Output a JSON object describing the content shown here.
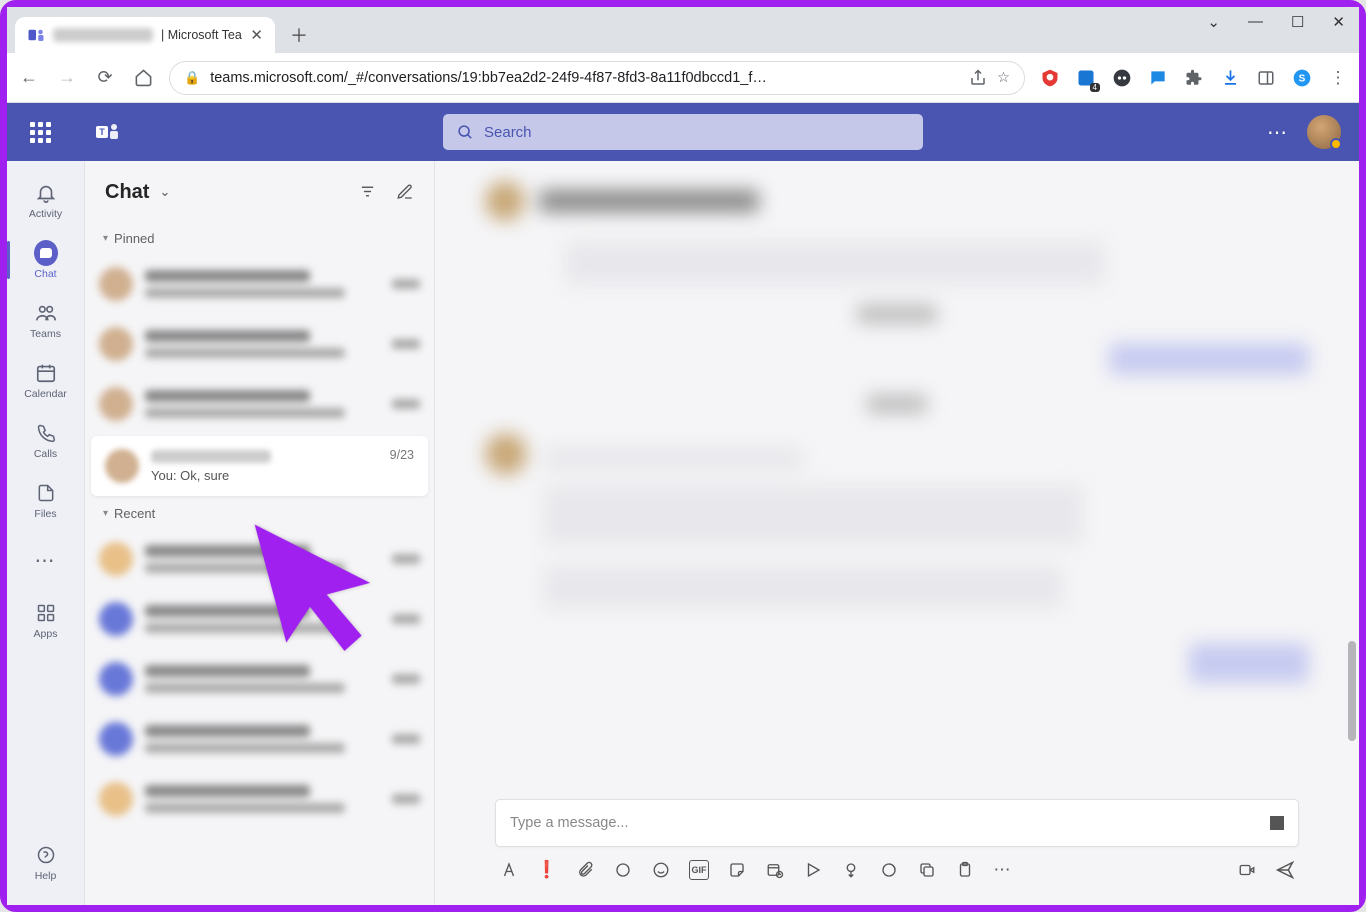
{
  "browser": {
    "tab_title_suffix": " | Microsoft Tea",
    "url": "teams.microsoft.com/_#/conversations/19:bb7ea2d2-24f9-4f87-8fd3-8a11f0dbccd1_f…"
  },
  "teams": {
    "search_placeholder": "Search",
    "rail": {
      "activity": "Activity",
      "chat": "Chat",
      "teams": "Teams",
      "calendar": "Calendar",
      "calls": "Calls",
      "files": "Files",
      "apps": "Apps",
      "help": "Help"
    },
    "chat_panel": {
      "title": "Chat",
      "pinned_label": "Pinned",
      "recent_label": "Recent",
      "active_item": {
        "preview": "You: Ok, sure",
        "time": "9/23"
      }
    },
    "compose_placeholder": "Type a message..."
  }
}
